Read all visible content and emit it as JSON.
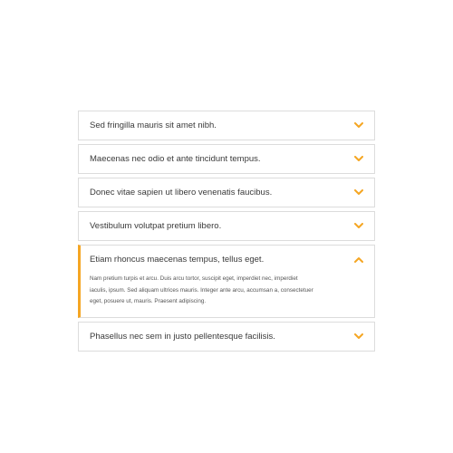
{
  "colors": {
    "accent": "#f5a623",
    "border": "#dcdcdc",
    "text": "#3a3a3a"
  },
  "accordion": {
    "items": [
      {
        "title": "Sed fringilla mauris sit amet nibh.",
        "icon": "chevron-down-icon",
        "open": false
      },
      {
        "title": "Maecenas nec odio et ante tincidunt tempus.",
        "icon": "chevron-down-icon",
        "open": false
      },
      {
        "title": "Donec vitae sapien ut libero venenatis faucibus.",
        "icon": "chevron-down-icon",
        "open": false
      },
      {
        "title": "Vestibulum volutpat pretium libero.",
        "icon": "chevron-down-icon",
        "open": false
      },
      {
        "title": "Etiam rhoncus maecenas tempus, tellus eget.",
        "icon": "chevron-up-icon",
        "open": true,
        "body_lines": [
          "Nam pretium turpis et arcu. Duis arcu tortor, suscipit eget, imperdiet nec, imperdiet",
          "iaculis, ipsum. Sed aliquam ultrices mauris. Integer ante arcu, accumsan a, consectetuer",
          "eget, posuere ut, mauris. Praesent adipiscing."
        ]
      },
      {
        "title": "Phasellus nec sem in justo pellentesque facilisis.",
        "icon": "chevron-down-icon",
        "open": false
      }
    ]
  }
}
